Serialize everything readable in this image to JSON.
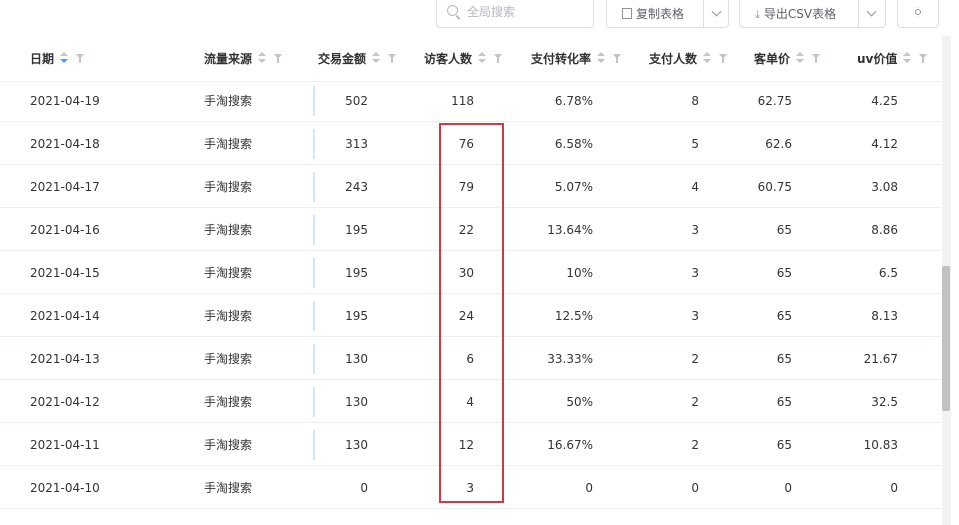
{
  "toolbar": {
    "search_placeholder": "全局搜索",
    "copy_label": "复制表格",
    "export_label": "导出CSV表格"
  },
  "icons": {
    "search": "search-icon",
    "copy": "copy-icon",
    "download": "download-icon",
    "settings": "gear-icon",
    "sort": "sort-icon",
    "filter": "filter-icon"
  },
  "colors": {
    "sort_active": "#409eff",
    "highlight_border": "#d9363e",
    "amount_bar": "#d3e6fa"
  },
  "table": {
    "columns": [
      "日期",
      "流量来源",
      "交易金额",
      "访客人数",
      "支付转化率",
      "支付人数",
      "客单价",
      "uv价值"
    ],
    "sorted_column": "日期",
    "rows": [
      [
        "2021-04-19",
        "手淘搜索",
        "502",
        "118",
        "6.78%",
        "8",
        "62.75",
        "4.25"
      ],
      [
        "2021-04-18",
        "手淘搜索",
        "313",
        "76",
        "6.58%",
        "5",
        "62.6",
        "4.12"
      ],
      [
        "2021-04-17",
        "手淘搜索",
        "243",
        "79",
        "5.07%",
        "4",
        "60.75",
        "3.08"
      ],
      [
        "2021-04-16",
        "手淘搜索",
        "195",
        "22",
        "13.64%",
        "3",
        "65",
        "8.86"
      ],
      [
        "2021-04-15",
        "手淘搜索",
        "195",
        "30",
        "10%",
        "3",
        "65",
        "6.5"
      ],
      [
        "2021-04-14",
        "手淘搜索",
        "195",
        "24",
        "12.5%",
        "3",
        "65",
        "8.13"
      ],
      [
        "2021-04-13",
        "手淘搜索",
        "130",
        "6",
        "33.33%",
        "2",
        "65",
        "21.67"
      ],
      [
        "2021-04-12",
        "手淘搜索",
        "130",
        "4",
        "50%",
        "2",
        "65",
        "32.5"
      ],
      [
        "2021-04-11",
        "手淘搜索",
        "130",
        "12",
        "16.67%",
        "2",
        "65",
        "10.83"
      ],
      [
        "2021-04-10",
        "手淘搜索",
        "0",
        "3",
        "0",
        "0",
        "0",
        "0"
      ]
    ]
  }
}
